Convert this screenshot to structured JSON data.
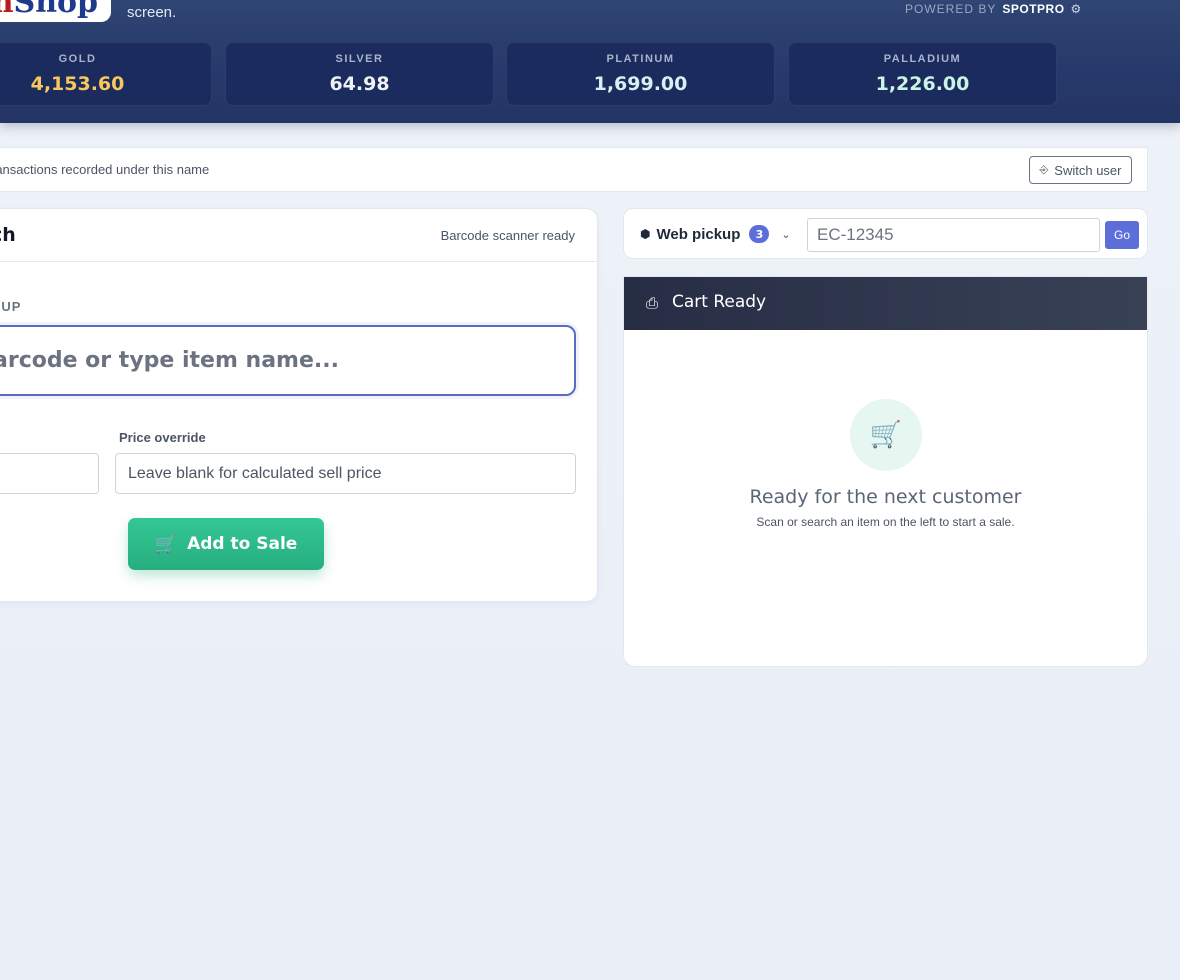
{
  "header": {
    "logo_part1": "n",
    "logo_part2": "Shop",
    "subtitle": "screen.",
    "powered_label": "POWERED BY",
    "powered_brand": "SPOTPRO",
    "settings_icon": "gear-icon"
  },
  "metals": [
    {
      "name": "GOLD",
      "price": "4,153.60",
      "color": "#f8c85a"
    },
    {
      "name": "SILVER",
      "price": "64.98",
      "color": "#eef1f6"
    },
    {
      "name": "PLATINUM",
      "price": "1,699.00",
      "color": "#d8f0f0"
    },
    {
      "name": "PALLADIUM",
      "price": "1,226.00",
      "color": "#c9f4e6"
    }
  ],
  "user_bar": {
    "text": "ransactions recorded under this name",
    "switch_label": "Switch user"
  },
  "search_panel": {
    "title": "ch",
    "scanner_status": "Barcode scanner ready",
    "field_label": "KUP",
    "search_placeholder": "arcode or type item name...",
    "price_override_label": "Price override",
    "price_override_placeholder": "Leave blank for calculated sell price",
    "add_button_label": "Add to Sale"
  },
  "pickup": {
    "label": "Web pickup",
    "count": "3",
    "order_placeholder": "EC-12345",
    "go_label": "Go"
  },
  "cart": {
    "title": "Cart Ready",
    "empty_title": "Ready for the next customer",
    "empty_subtitle": "Scan or search an item on the left to start a sale."
  },
  "colors": {
    "accent": "#5c6fd8",
    "success": "#2fbf8b",
    "header_bg": "#27396a"
  }
}
